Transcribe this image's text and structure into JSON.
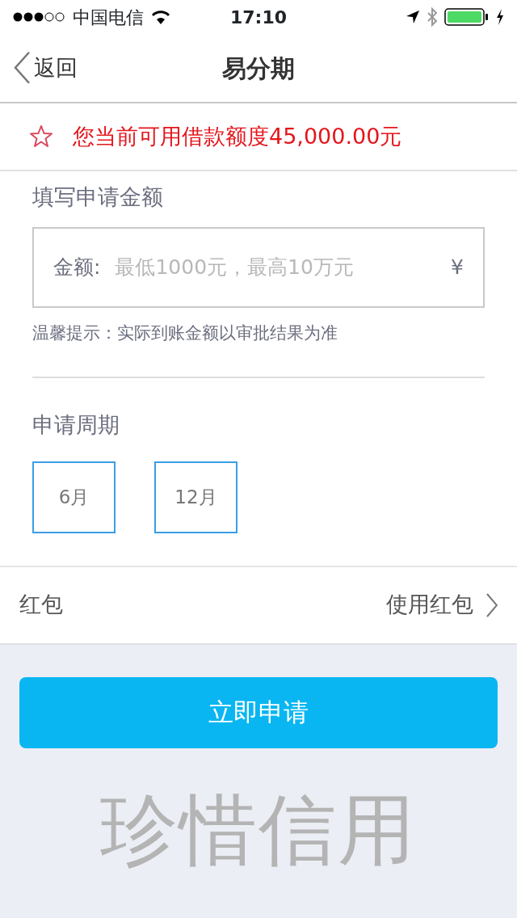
{
  "status_bar": {
    "carrier": "中国电信",
    "time": "17:10"
  },
  "nav": {
    "back": "返回",
    "title": "易分期"
  },
  "credit_notice": "您当前可用借款额度45,000.00元",
  "amount": {
    "heading": "填写申请金额",
    "label": "金额:",
    "placeholder": "最低1000元，最高10万元",
    "currency": "¥",
    "hint": "温馨提示：实际到账金额以审批结果为准"
  },
  "period": {
    "heading": "申请周期",
    "options": [
      {
        "label": "6月",
        "selected": false
      },
      {
        "label": "12月",
        "selected": false
      }
    ]
  },
  "red_packet": {
    "label": "红包",
    "action": "使用红包"
  },
  "apply_button": "立即申请",
  "slogan": "珍惜信用"
}
